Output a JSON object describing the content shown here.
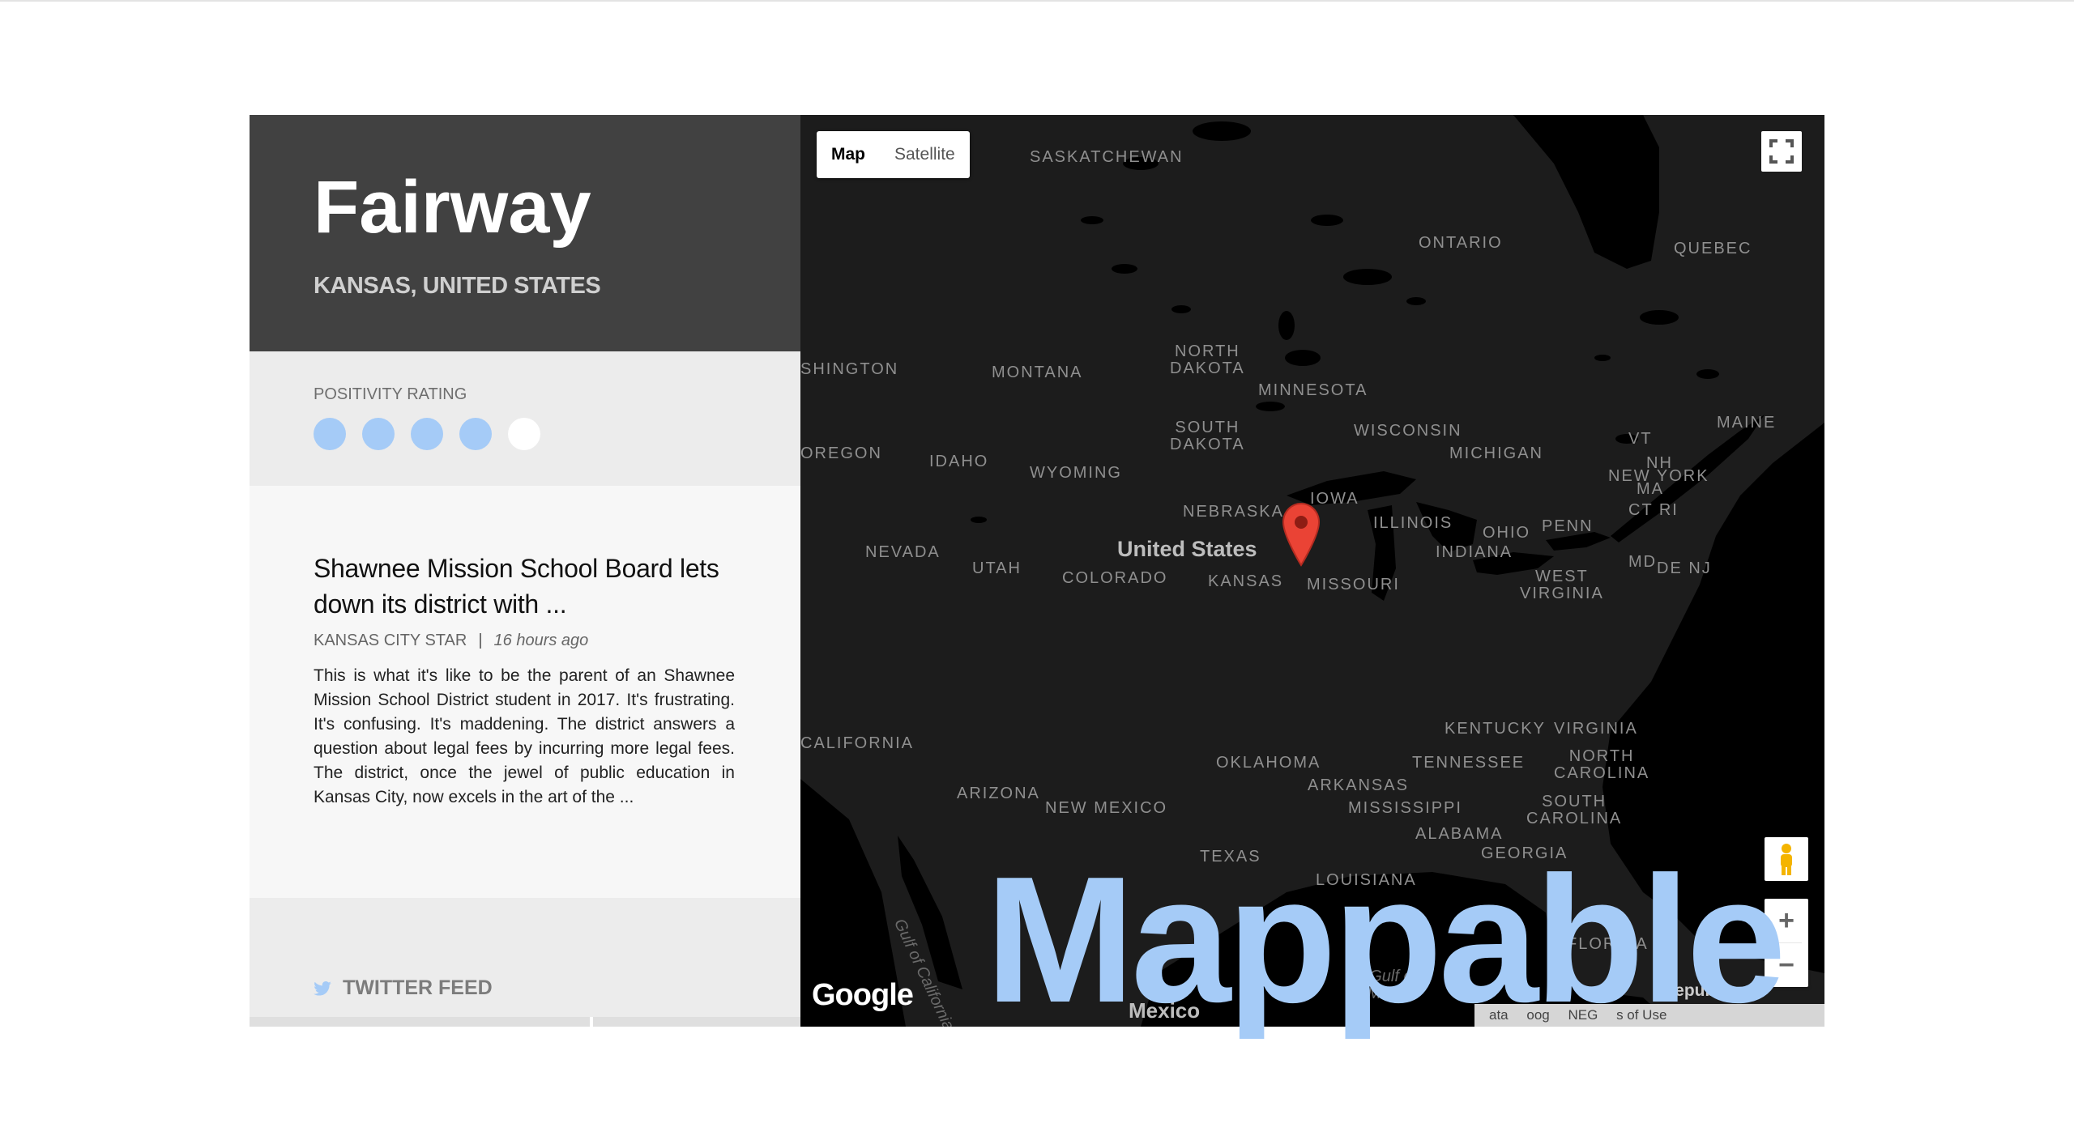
{
  "place": {
    "city": "Fairway",
    "region": "KANSAS, UNITED STATES"
  },
  "rating": {
    "label": "POSITIVITY RATING",
    "value": 4,
    "max": 5,
    "color": "#a5cbf7"
  },
  "news": {
    "title": "Shawnee Mission School Board lets down its district with ...",
    "source": "KANSAS CITY STAR",
    "separator": "|",
    "time": "16 hours ago",
    "body": "This is what it's like to be the parent of an Shawnee Mission School District student in 2017. It's frustrating. It's confusing. It's maddening. The district answers a question about legal fees by incurring more legal fees. The district, once the jewel of public education in Kansas City, now excels in the art of the ..."
  },
  "twitter": {
    "label": "TWITTER FEED",
    "icon": "twitter-bird-icon"
  },
  "map": {
    "type_buttons": [
      "Map",
      "Satellite"
    ],
    "active_type": "Map",
    "labels": {
      "saskatchewan": "SASKATCHEWAN",
      "ontario": "ONTARIO",
      "quebec": "QUEBEC",
      "washington": "SHINGTON",
      "montana": "MONTANA",
      "north_dakota": "NORTH\nDAKOTA",
      "minnesota": "MINNESOTA",
      "south_dakota": "SOUTH\nDAKOTA",
      "wisconsin": "WISCONSIN",
      "michigan": "MICHIGAN",
      "vt": "VT",
      "maine": "MAINE",
      "nh": "NH",
      "oregon": "OREGON",
      "idaho": "IDAHO",
      "wyoming": "WYOMING",
      "iowa": "IOWA",
      "new_york": "NEW YORK",
      "ma": "MA",
      "ct_ri": "CT RI",
      "nebraska": "NEBRASKA",
      "illinois": "ILLINOIS",
      "ohio": "OHIO",
      "penn": "PENN",
      "nevada": "NEVADA",
      "utah": "UTAH",
      "united_states": "United States",
      "colorado": "COLORADO",
      "kansas": "KANSAS",
      "missouri": "MISSOURI",
      "indiana": "INDIANA",
      "md": "MD",
      "de_nj": "DE NJ",
      "west_virginia": "WEST\nVIRGINIA",
      "california": "CALIFORNIA",
      "kentucky": "KENTUCKY",
      "virginia": "VIRGINIA",
      "oklahoma": "OKLAHOMA",
      "tennessee": "TENNESSEE",
      "north_carolina": "NORTH\nCAROLINA",
      "arizona": "ARIZONA",
      "arkansas": "ARKANSAS",
      "new_mexico": "NEW MEXICO",
      "mississippi": "MISSISSIPPI",
      "south_carolina": "SOUTH\nCAROLINA",
      "alabama": "ALABAMA",
      "texas": "TEXAS",
      "georgia": "GEORGIA",
      "louisiana": "LOUISIANA",
      "gulf_of_california": "Gulf of California",
      "florida": "FLORIDA",
      "gulf_of_mexico": "Gulf of\nMexico",
      "mexico": "Mexico"
    },
    "logo": "Google",
    "republic": "Republic",
    "attribution": [
      "ata",
      "oog",
      "NEG",
      "s of Use"
    ],
    "zoom_in": "+",
    "zoom_out": "−",
    "marker_color": "#ea4335"
  },
  "watermark": "Mappable"
}
